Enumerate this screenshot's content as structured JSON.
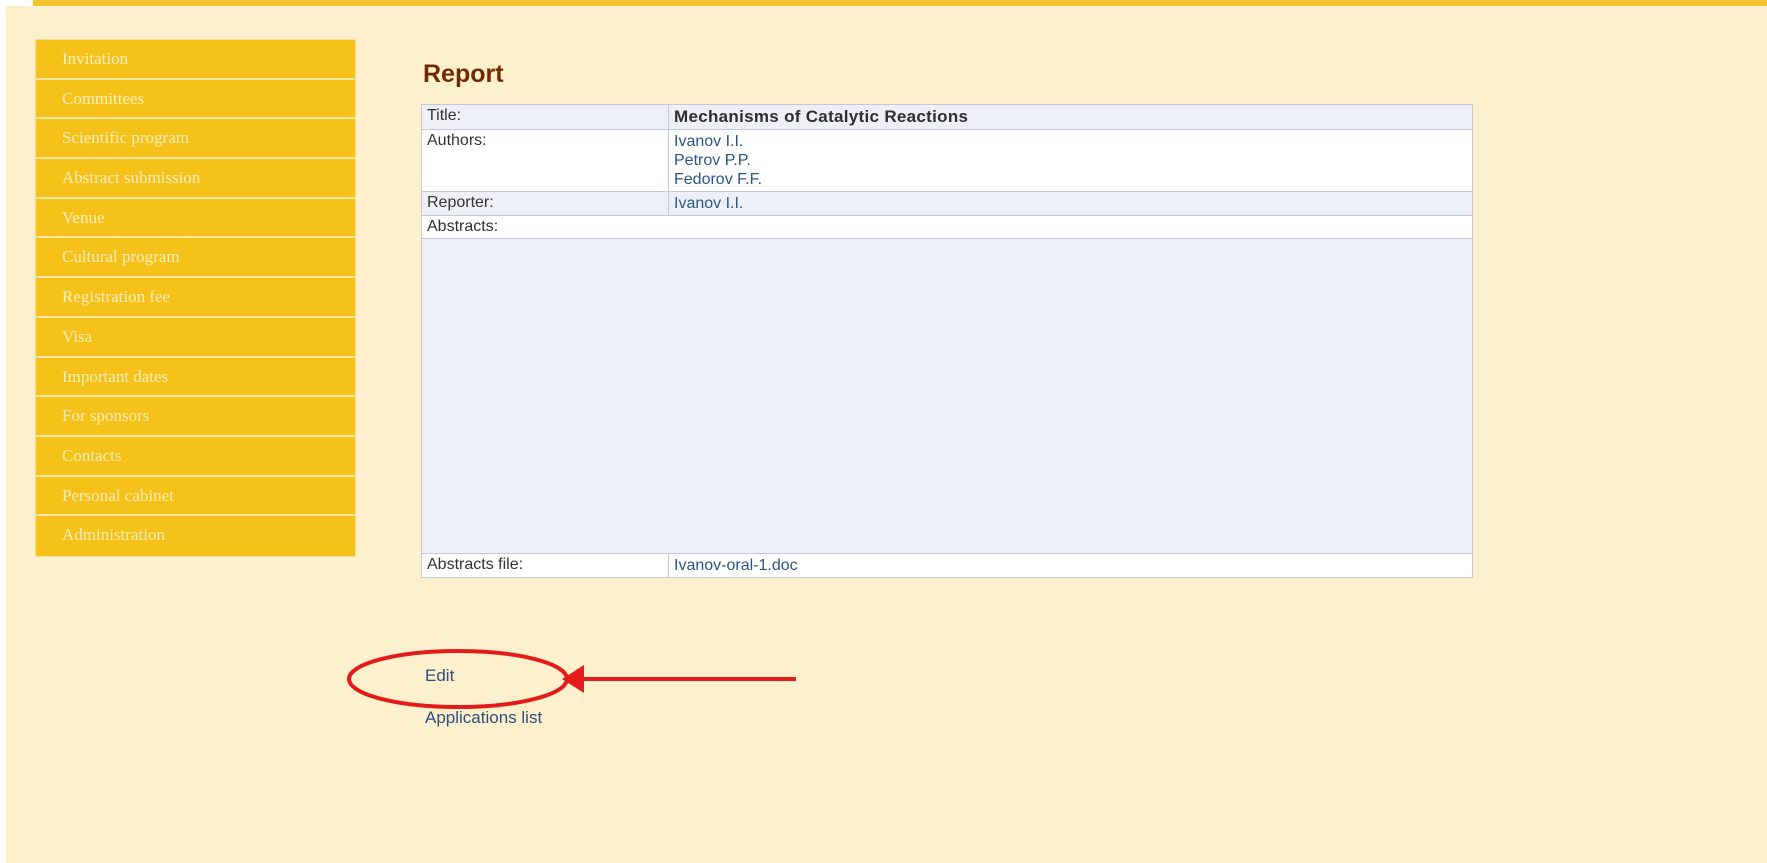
{
  "sidebar": {
    "items": [
      {
        "label": "Invitation"
      },
      {
        "label": "Committees"
      },
      {
        "label": "Scientific program"
      },
      {
        "label": "Abstract submission"
      },
      {
        "label": "Venue"
      },
      {
        "label": "Cultural program"
      },
      {
        "label": "Registration fee"
      },
      {
        "label": "Visa"
      },
      {
        "label": "Important dates"
      },
      {
        "label": "For sponsors"
      },
      {
        "label": "Contacts"
      },
      {
        "label": "Personal cabinet"
      },
      {
        "label": "Administration"
      }
    ]
  },
  "main": {
    "heading": "Report",
    "report": {
      "title_label": "Title:",
      "title_value": "Mechanisms of Catalytic Reactions",
      "authors_label": "Authors:",
      "authors": [
        "Ivanov I.I.",
        "Petrov P.P.",
        "Fedorov F.F."
      ],
      "reporter_label": "Reporter:",
      "reporter": "Ivanov I.I.",
      "abstracts_label": "Abstracts:",
      "abstracts_file_label": "Abstracts file:",
      "abstracts_file": "Ivanov-oral-1.doc"
    },
    "actions": {
      "edit": "Edit",
      "applications_list": "Applications list"
    }
  },
  "colors": {
    "page_background": "#fdf0cc",
    "sidebar_background": "#f6c21a",
    "heading": "#6e2c05",
    "link": "#2a5586",
    "annotation": "#e41b1b"
  },
  "annotation": {
    "circled_element": "Edit",
    "arrow_direction": "left"
  }
}
